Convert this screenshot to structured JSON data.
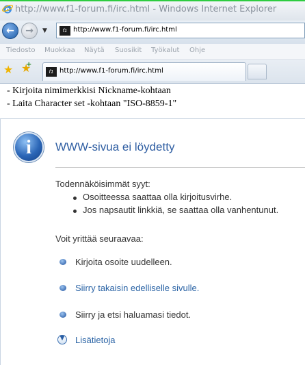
{
  "window": {
    "title": "http://www.f1-forum.fi/irc.html - Windows Internet Explorer"
  },
  "address": {
    "url": "http://www.f1-forum.fi/irc.html",
    "favicon_text": "f1"
  },
  "menu": [
    "Tiedosto",
    "Muokkaa",
    "Näytä",
    "Suosikit",
    "Työkalut",
    "Ohje"
  ],
  "tab": {
    "label": "http://www.f1-forum.fi/irc.html"
  },
  "page_top": {
    "lines": [
      "- Kirjoita nimimerkkisi Nickname-kohtaan",
      "- Laita Character set -kohtaan \"ISO-8859-1\""
    ]
  },
  "error": {
    "title": "WWW-sivua ei löydetty",
    "causes_heading": "Todennäköisimmät syyt:",
    "causes": [
      "Osoitteessa saattaa olla kirjoitusvirhe.",
      "Jos napsautit linkkiä, se saattaa olla vanhentunut."
    ],
    "try_heading": "Voit yrittää seuraavaa:",
    "actions": [
      "Kirjoita osoite uudelleen.",
      "Siirry takaisin edelliselle sivulle.",
      "Siirry  ja etsi haluamasi tiedot."
    ],
    "more_info": "Lisätietoja"
  },
  "icons": {
    "back": "back-arrow-icon",
    "forward": "forward-arrow-icon",
    "favorites": "favorites-star-icon",
    "add_favorites": "add-to-favorites-icon",
    "info": "info-icon",
    "more_info": "chevron-down-circle-icon"
  }
}
